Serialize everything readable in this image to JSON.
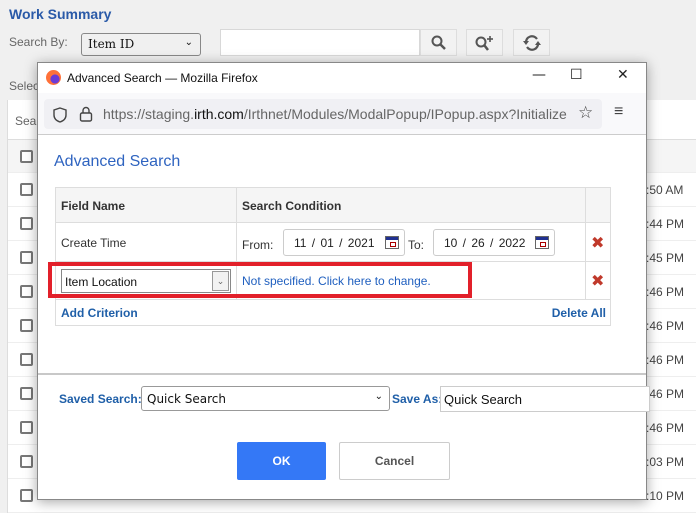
{
  "page": {
    "title": "Work Summary",
    "search_by_label": "Search By:",
    "search_by_value": "Item ID",
    "search_value": "",
    "select_text": "Selec",
    "search_text": "Sea",
    "row_times": [
      ":50 AM",
      ":44 PM",
      ":45 PM",
      ":46 PM",
      ":46 PM",
      ":46 PM",
      ":46 PM",
      ":46 PM",
      ":03 PM",
      ":10 PM"
    ],
    "toolbar_icons": [
      "search-icon",
      "advanced-search-icon",
      "refresh-icon"
    ]
  },
  "window": {
    "title": "Advanced Search — Mozilla Firefox",
    "url_prefix": "https://staging.",
    "url_domain": "irth.com",
    "url_suffix": "/Irthnet/Modules/ModalPopup/IPopup.aspx?Initialize",
    "controls": {
      "minimize": "—",
      "maximize": "☐",
      "close": "✕"
    }
  },
  "dialog": {
    "heading": "Advanced Search",
    "columns": [
      "Field Name",
      "Search Condition"
    ],
    "criteria": [
      {
        "field": "Create Time",
        "from_label": "From:",
        "from_date": "11 / 01 / 2021",
        "to_label": "To:",
        "to_date": "10 / 26 / 2022"
      },
      {
        "field": "Item Location",
        "condition": "Not specified. Click here to change."
      }
    ],
    "add_criterion": "Add Criterion",
    "delete_all": "Delete All",
    "saved_search_label": "Saved Search:",
    "saved_search_value": "Quick Search",
    "save_as_label": "Save As:",
    "save_as_value": "Quick Search",
    "ok_label": "OK",
    "cancel_label": "Cancel"
  },
  "colors": {
    "accent": "#3478f6",
    "link": "#1f5fa8",
    "highlight": "#e2202a",
    "delete": "#c0392b"
  }
}
